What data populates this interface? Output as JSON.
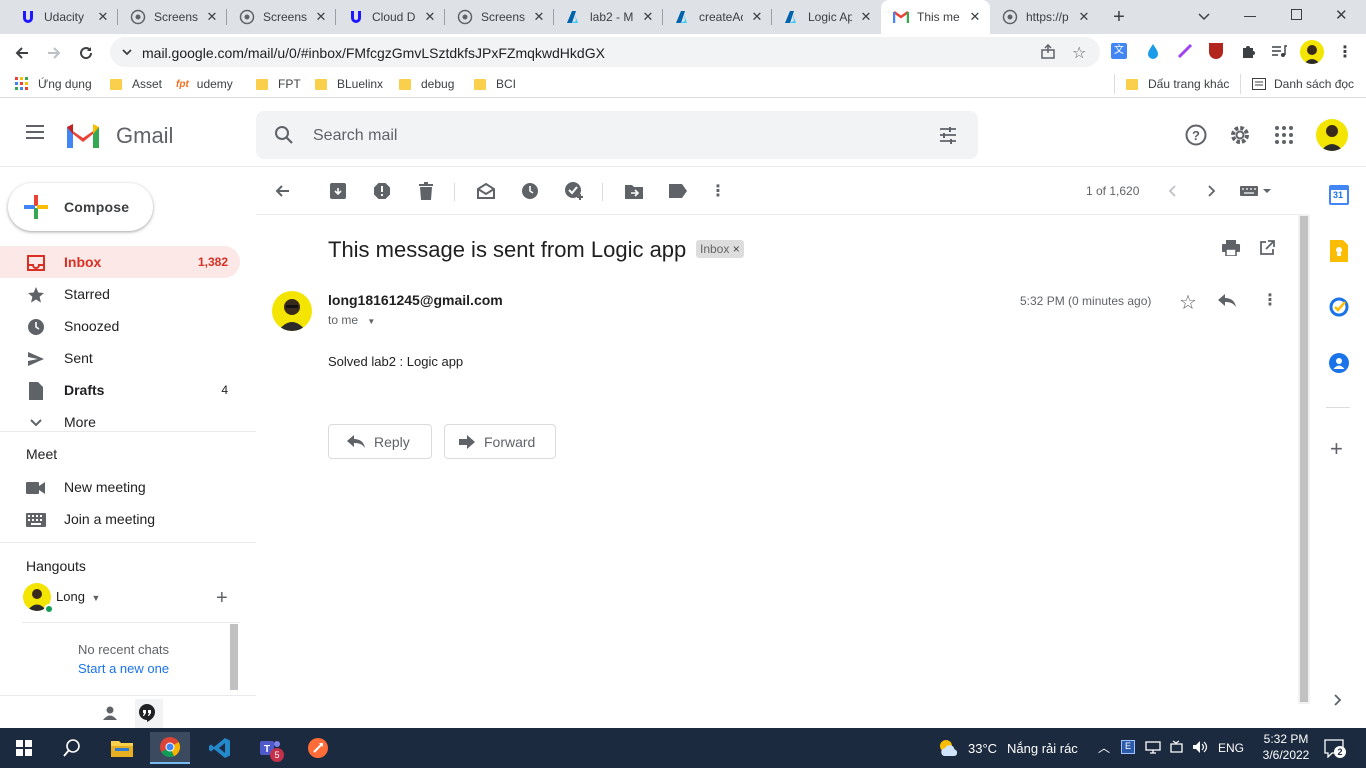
{
  "browser": {
    "tabs": [
      {
        "label": "Udacity",
        "icon": "udacity-icon"
      },
      {
        "label": "Screensh",
        "icon": "globe-icon"
      },
      {
        "label": "Screensh",
        "icon": "globe-icon"
      },
      {
        "label": "Cloud D",
        "icon": "udacity-icon"
      },
      {
        "label": "Screensh",
        "icon": "globe-icon"
      },
      {
        "label": "lab2 - M",
        "icon": "azure-icon"
      },
      {
        "label": "createAc",
        "icon": "azure-icon"
      },
      {
        "label": "Logic Ap",
        "icon": "azure-icon"
      },
      {
        "label": "This me",
        "icon": "gmail-icon",
        "active": true
      },
      {
        "label": "https://p",
        "icon": "globe-icon"
      }
    ],
    "url": "mail.google.com/mail/u/0/#inbox/FMfcgzGmvLSztdkfsJPxFZmqkwdHkdGX",
    "bookmarks": {
      "apps": "Ứng dụng",
      "items": [
        "Asset",
        "udemy",
        "FPT",
        "BLuelinx",
        "debug",
        "BCI"
      ],
      "other": "Dấu trang khác",
      "reading_list": "Danh sách đọc"
    }
  },
  "gmail": {
    "logo_text": "Gmail",
    "search_placeholder": "Search mail",
    "compose_label": "Compose",
    "nav": [
      {
        "label": "Inbox",
        "count": "1,382",
        "icon": "inbox-icon"
      },
      {
        "label": "Starred",
        "count": "",
        "icon": "star-icon"
      },
      {
        "label": "Snoozed",
        "count": "",
        "icon": "clock-icon"
      },
      {
        "label": "Sent",
        "count": "",
        "icon": "send-icon"
      },
      {
        "label": "Drafts",
        "count": "4",
        "icon": "draft-icon"
      },
      {
        "label": "More",
        "count": "",
        "icon": "chevron-down-icon"
      }
    ],
    "meet": {
      "title": "Meet",
      "new_meeting": "New meeting",
      "join_meeting": "Join a meeting"
    },
    "hangouts": {
      "title": "Hangouts",
      "user": "Long",
      "no_chats": "No recent chats",
      "start_new": "Start a new one"
    },
    "pager": "1 of 1,620",
    "message": {
      "subject": "This message is sent from Logic app",
      "label": "Inbox",
      "sender": "long18161245@gmail.com",
      "to": "to me",
      "time": "5:32 PM (0 minutes ago)",
      "body": "Solved lab2 : Logic app",
      "reply_label": "Reply",
      "forward_label": "Forward"
    },
    "rail_calendar_day": "31"
  },
  "taskbar": {
    "weather_temp": "33°C",
    "weather_desc": "Nắng rải rác",
    "lang": "ENG",
    "time": "5:32 PM",
    "date": "3/6/2022",
    "notifications": "2",
    "teams_badge": "5"
  },
  "colors": {
    "gmail_red": "#d93025",
    "inbox_active_bg": "#fce8e6",
    "link_blue": "#1a73e8",
    "taskbar_bg": "#1b2a3f"
  }
}
